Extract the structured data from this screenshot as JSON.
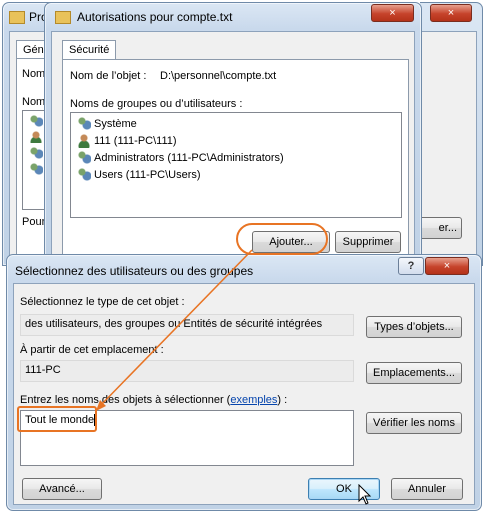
{
  "bg_window": {
    "title_partial": "Pro",
    "tab_partial": "Géné",
    "label_nom": "Nom",
    "label_noms": "Noms",
    "label_pour": "Pour",
    "btn_partial": "er..."
  },
  "perm_dialog": {
    "title": "Autorisations pour compte.txt",
    "close_glyph": "×",
    "tab_label": "Sécurité",
    "object_name_label": "Nom de l’objet :",
    "object_name_value": "D:\\personnel\\compte.txt",
    "groups_label": "Noms de groupes ou d’utilisateurs :",
    "users": [
      {
        "name": "Système",
        "icon": "group-icon"
      },
      {
        "name": "111 (111-PC\\111)",
        "icon": "user-icon"
      },
      {
        "name": "Administrators (111-PC\\Administrators)",
        "icon": "group-icon"
      },
      {
        "name": "Users (111-PC\\Users)",
        "icon": "group-icon"
      }
    ],
    "add_button": "Ajouter...",
    "remove_button": "Supprimer"
  },
  "select_dialog": {
    "title": "Sélectionnez des utilisateurs ou des groupes",
    "help_glyph": "?",
    "close_glyph": "×",
    "type_label": "Sélectionnez le type de cet objet :",
    "type_value": "des utilisateurs, des groupes ou Entités de sécurité intégrées",
    "object_types_button": "Types d’objets...",
    "location_label": "À partir de cet emplacement :",
    "location_value": "111-PC",
    "locations_button": "Emplacements...",
    "names_label_prefix": "Entrez les noms des objets à sélectionner (",
    "names_label_link": "exemples",
    "names_label_suffix": ") :",
    "names_value": "Tout le monde",
    "check_names_button": "Vérifier les noms",
    "advanced_button": "Avancé...",
    "ok_button": "OK",
    "cancel_button": "Annuler"
  },
  "colors": {
    "annotation": "#e87424",
    "link": "#0645ad"
  }
}
